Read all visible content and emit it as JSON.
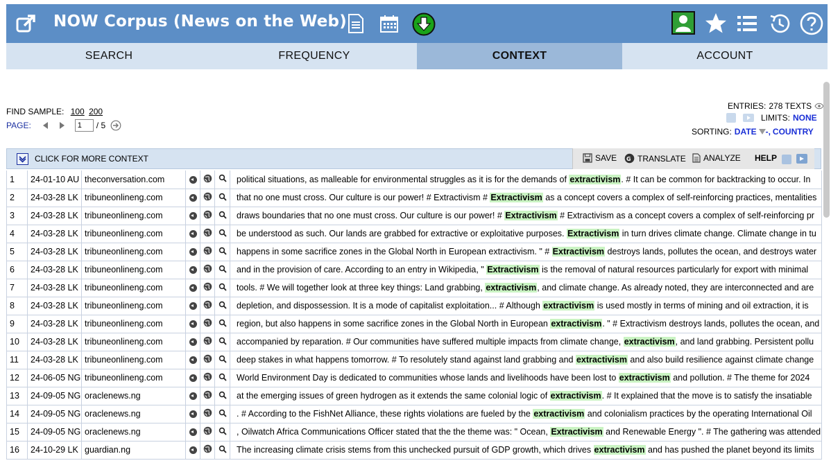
{
  "header": {
    "title": "NOW Corpus (News on the Web)",
    "icons": [
      "external-link-icon",
      "document-icon",
      "calendar-icon",
      "download-icon",
      "user-icon",
      "star-icon",
      "list-icon",
      "history-icon",
      "help-icon"
    ]
  },
  "tabs": [
    {
      "label": "SEARCH",
      "active": false
    },
    {
      "label": "FREQUENCY",
      "active": false
    },
    {
      "label": "CONTEXT",
      "active": true
    },
    {
      "label": "ACCOUNT",
      "active": false
    }
  ],
  "controls": {
    "find_sample_label": "FIND SAMPLE:",
    "sample_100": "100",
    "sample_200": "200",
    "page_label": "PAGE:",
    "page_value": "1",
    "page_total": "/ 5",
    "entries_label": "ENTRIES:",
    "entries_value": "278 TEXTS",
    "limits_label": "LIMITS:",
    "limits_value": "NONE",
    "sorting_label": "SORTING:",
    "sorting_date": "DATE",
    "sorting_sep": "-,",
    "sorting_country": "COUNTRY"
  },
  "toolbar": {
    "more_context": "CLICK FOR MORE CONTEXT",
    "save": "SAVE",
    "translate": "TRANSLATE",
    "analyze": "ANALYZE",
    "help": "HELP"
  },
  "colors": {
    "header_bg": "#5c8ec6",
    "tab_bg": "#d6e3f1",
    "tab_active_bg": "#9bb8d9",
    "keyword_bg": "#c9f3c2",
    "accent_blue": "#1a2fd6"
  },
  "rows": [
    {
      "num": "1",
      "date": "24-01-10 AU",
      "source": "theconversation.com",
      "before": "political situations, as malleable for environmental struggles as it is for the demands of ",
      "keyword": "extractivism",
      "after": ". # It can be common for backtracking to occur. In"
    },
    {
      "num": "2",
      "date": "24-03-28 LK",
      "source": "tribuneonlineng.com",
      "before": "that no one must cross. Our culture is our power! # Extractivism # ",
      "keyword": "Extractivism",
      "after": " as a concept covers a complex of self-reinforcing practices, mentalities"
    },
    {
      "num": "3",
      "date": "24-03-28 LK",
      "source": "tribuneonlineng.com",
      "before": "draws boundaries that no one must cross. Our culture is our power! # ",
      "keyword": "Extractivism",
      "after": " # Extractivism as a concept covers a complex of self-reinforcing pr"
    },
    {
      "num": "4",
      "date": "24-03-28 LK",
      "source": "tribuneonlineng.com",
      "before": "be understood as such. Our lands are grabbed for extractive or exploitative purposes. ",
      "keyword": "Extractivism",
      "after": " in turn drives climate change. Climate change in tu"
    },
    {
      "num": "5",
      "date": "24-03-28 LK",
      "source": "tribuneonlineng.com",
      "before": "happens in some sacrifice zones in the Global North in European extractivism. \" # ",
      "keyword": "Extractivism",
      "after": " destroys lands, pollutes the ocean, and destroys water"
    },
    {
      "num": "6",
      "date": "24-03-28 LK",
      "source": "tribuneonlineng.com",
      "before": "and in the provision of care. According to an entry in Wikipedia, \" ",
      "keyword": "Extractivism",
      "after": " is the removal of natural resources particularly for export with minimal"
    },
    {
      "num": "7",
      "date": "24-03-28 LK",
      "source": "tribuneonlineng.com",
      "before": "tools. # We will together look at three key things: Land grabbing, ",
      "keyword": "extractivism",
      "after": ", and climate change. As already noted, they are interconnected and are"
    },
    {
      "num": "8",
      "date": "24-03-28 LK",
      "source": "tribuneonlineng.com",
      "before": "depletion, and dispossession. It is a mode of capitalist exploitation... # Although ",
      "keyword": "extractivism",
      "after": " is used mostly in terms of mining and oil extraction, it is"
    },
    {
      "num": "9",
      "date": "24-03-28 LK",
      "source": "tribuneonlineng.com",
      "before": "region, but also happens in some sacrifice zones in the Global North in European ",
      "keyword": "extractivism",
      "after": ". \" # Extractivism destroys lands, pollutes the ocean, and"
    },
    {
      "num": "10",
      "date": "24-03-28 LK",
      "source": "tribuneonlineng.com",
      "before": "accompanied by reparation. # Our communities have suffered multiple impacts from climate change, ",
      "keyword": "extractivism",
      "after": ", and land grabbing. Persistent pollu"
    },
    {
      "num": "11",
      "date": "24-03-28 LK",
      "source": "tribuneonlineng.com",
      "before": "deep stakes in what happens tomorrow. # To resolutely stand against land grabbing and ",
      "keyword": "extractivism",
      "after": " and also build resilience against climate change"
    },
    {
      "num": "12",
      "date": "24-06-05 NG",
      "source": "tribuneonlineng.com",
      "before": "World Environment Day is dedicated to communities whose lands and livelihoods have been lost to ",
      "keyword": "extractivism",
      "after": " and pollution. # The theme for 2024"
    },
    {
      "num": "13",
      "date": "24-09-05 NG",
      "source": "oraclenews.ng",
      "before": "at the emerging issues of green hydrogen as it extends the same colonial logic of ",
      "keyword": "extractivism",
      "after": ". # It explained that the move is to satisfy the insatiable"
    },
    {
      "num": "14",
      "date": "24-09-05 NG",
      "source": "oraclenews.ng",
      "before": ". # According to the FishNet Alliance, these rights violations are fueled by the ",
      "keyword": "extractivism",
      "after": " and colonialism practices by the operating International Oil"
    },
    {
      "num": "15",
      "date": "24-09-05 NG",
      "source": "oraclenews.ng",
      "before": ", Oilwatch Africa Communications Officer stated that the the theme was: \" Ocean, ",
      "keyword": "Extractivism",
      "after": " and Renewable Energy \". # The gathering was attended"
    },
    {
      "num": "16",
      "date": "24-10-29 LK",
      "source": "guardian.ng",
      "before": "The increasing climate crisis stems from this unchecked pursuit of GDP growth, which drives ",
      "keyword": "extractivism",
      "after": " and has pushed the planet beyond its limits"
    }
  ]
}
